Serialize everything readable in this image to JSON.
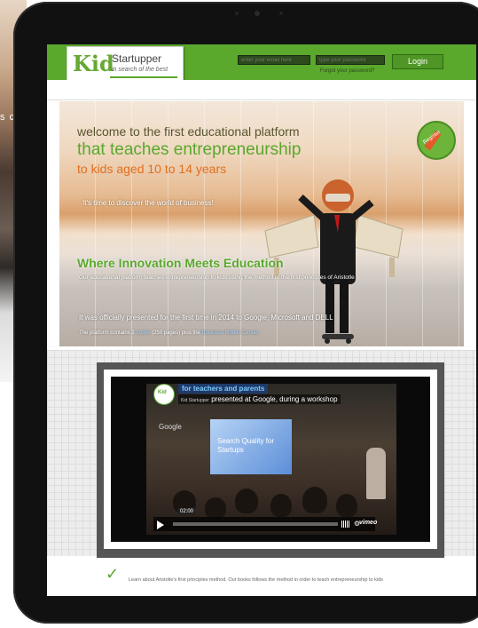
{
  "page": {
    "background_partial_text": "s c"
  },
  "header": {
    "logo": {
      "kid": "Kid",
      "name": "Startupper",
      "tagline": "in search of the best"
    },
    "email_placeholder": "enter your email here",
    "password_placeholder": "type your password",
    "forgot_password": "Forgot your password?",
    "login_label": "Login"
  },
  "hero": {
    "line1": "welcome to the first educational platform",
    "line2": "that teaches entrepreneurship",
    "line3": "to kids aged 10 to 14 years",
    "discover": "It's time to discover the world of business!",
    "headline": "Where Innovation Meets Education",
    "description": "Our educational platform teaches entrepreneurship to kids using the method of the first principles of Aristotle",
    "presented": "It was officially presented for the first time in 2014 to Google, Microsoft and DELL",
    "platform_prefix": "The platform contains 2",
    "platform_books": "books",
    "platform_mid": "(250 pages) plus the",
    "platform_canvas": "Business Model Canvas",
    "badge_label": "Register"
  },
  "video": {
    "logo_text": "Kid",
    "tag": "for teachers and parents",
    "title_small": "Kid Startupper",
    "title": "presented at Google, during a workshop",
    "google_label": "Google",
    "projector_text": "Search Quality for Startups",
    "time": "02:00",
    "progress": 0.0,
    "player_brand": "vimeo"
  },
  "bottom": {
    "text_prefix": "Learn about Aristotle's first principles method. Our books follows the method in order to teach entrepreneurship to kids"
  },
  "colors": {
    "brand_green": "#5aa82c",
    "accent_orange": "#e06f1f"
  }
}
